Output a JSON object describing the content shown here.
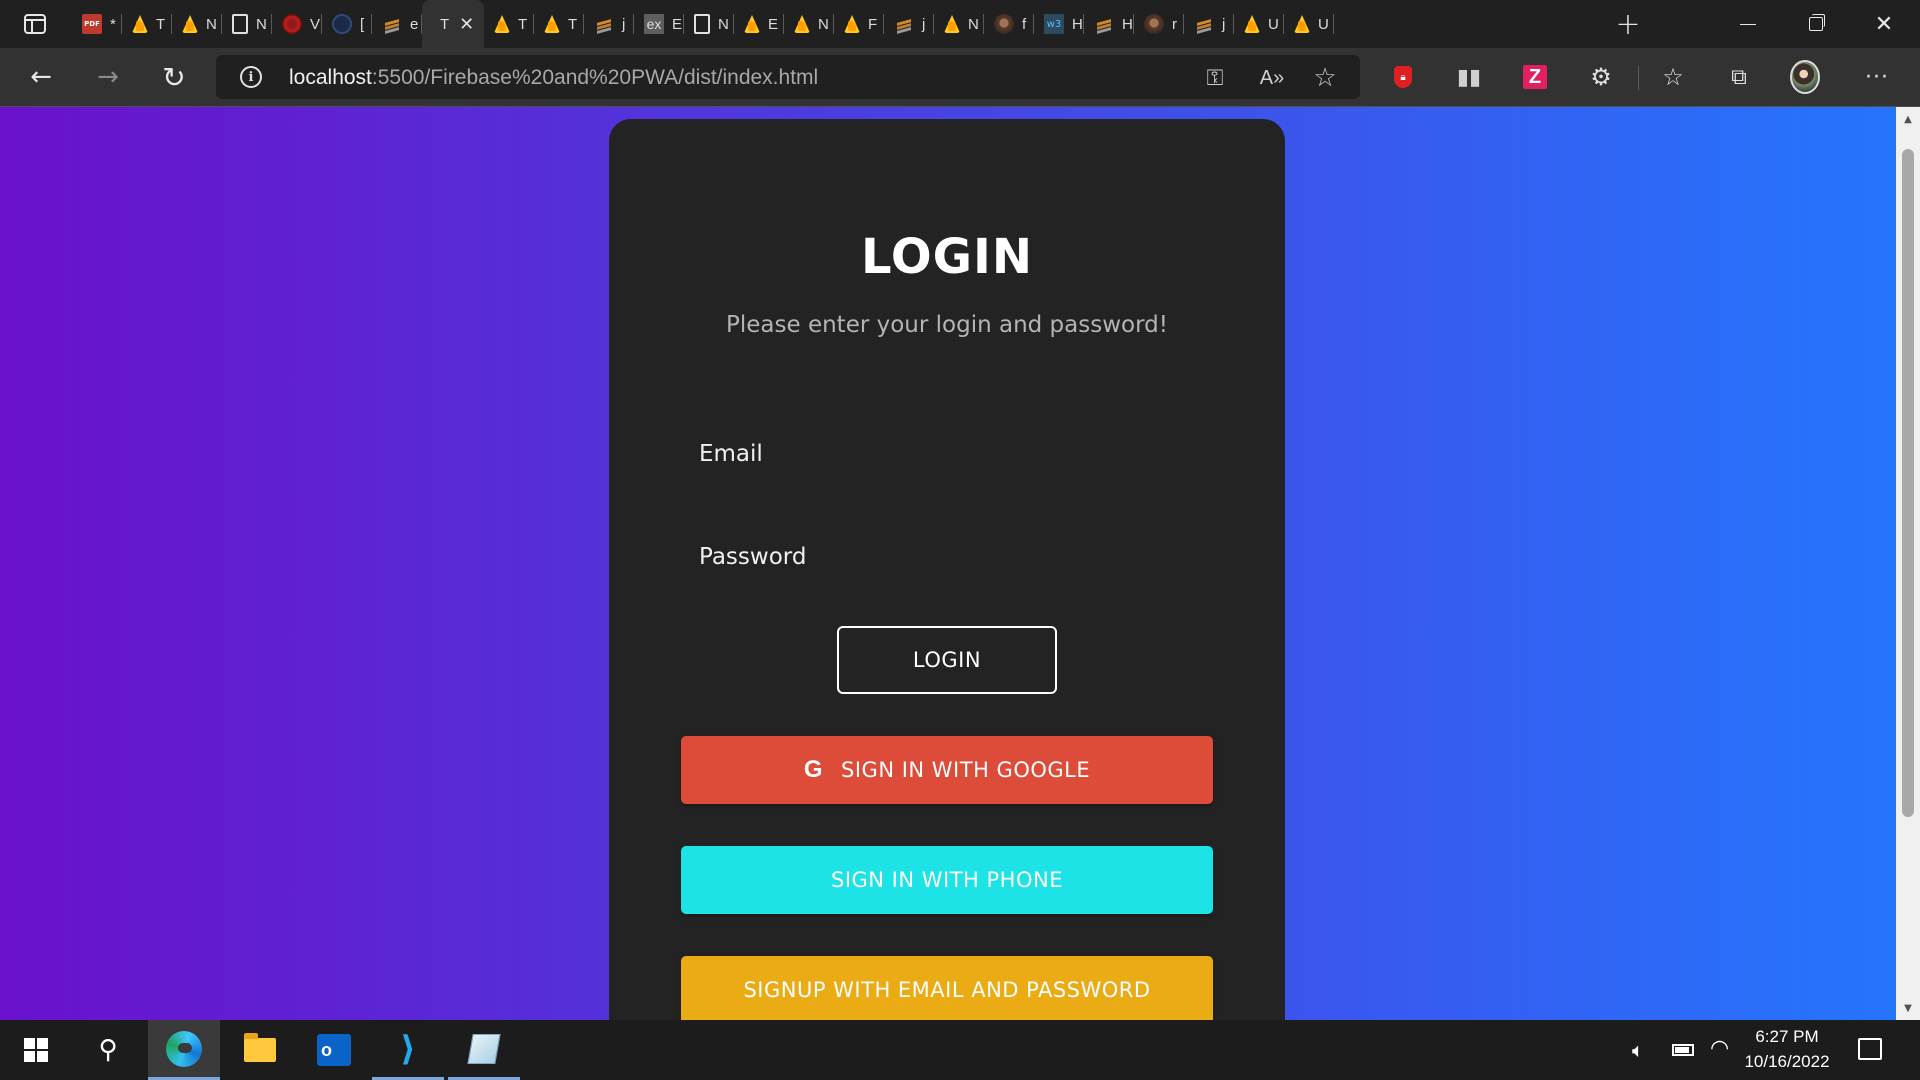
{
  "browser": {
    "tabs": [
      {
        "icon": "pdf-icon",
        "title": "*"
      },
      {
        "icon": "firebase-icon",
        "title": "T"
      },
      {
        "icon": "firebase-icon",
        "title": "N"
      },
      {
        "icon": "page-icon",
        "title": "N"
      },
      {
        "icon": "red-circle-icon",
        "title": "V"
      },
      {
        "icon": "blue-circle-icon",
        "title": "["
      },
      {
        "icon": "stackoverflow-icon",
        "title": "e"
      },
      {
        "icon": "active",
        "title": "T",
        "active": true
      },
      {
        "icon": "firebase-icon",
        "title": "T"
      },
      {
        "icon": "firebase-icon",
        "title": "T"
      },
      {
        "icon": "stackoverflow-icon",
        "title": "j"
      },
      {
        "icon": "ex-icon",
        "title": "E"
      },
      {
        "icon": "page-icon",
        "title": "N"
      },
      {
        "icon": "firebase-icon",
        "title": "E"
      },
      {
        "icon": "firebase-icon",
        "title": "N"
      },
      {
        "icon": "firebase-icon",
        "title": "F"
      },
      {
        "icon": "stackoverflow-icon",
        "title": "j"
      },
      {
        "icon": "firebase-icon",
        "title": "N"
      },
      {
        "icon": "avatar-icon",
        "title": "f"
      },
      {
        "icon": "w3-icon",
        "title": "H"
      },
      {
        "icon": "stackoverflow-icon",
        "title": "H"
      },
      {
        "icon": "avatar-icon",
        "title": "r"
      },
      {
        "icon": "stackoverflow-icon",
        "title": "j"
      },
      {
        "icon": "firebase-icon",
        "title": "U"
      },
      {
        "icon": "firebase-icon",
        "title": "U"
      }
    ],
    "address_bar": {
      "host": "localhost",
      "path": ":5500/Firebase%20and%20PWA/dist/index.html"
    },
    "read_aloud_label": "A»",
    "more_label": "···"
  },
  "page": {
    "title": "LOGIN",
    "subtitle": "Please enter your login and password!",
    "email_label": "Email",
    "password_label": "Password",
    "login_button": "LOGIN",
    "google_icon_letter": "G",
    "google_button": "SIGN IN WITH GOOGLE",
    "phone_button": "SIGN IN WITH PHONE",
    "signup_button": "SIGNUP WITH EMAIL AND PASSWORD",
    "colors": {
      "gradient_start": "#6a11cb",
      "gradient_end": "#2575fc",
      "card": "#232323",
      "google": "#dd4b39",
      "phone": "#1de2e6",
      "signup": "#eaab14"
    }
  },
  "taskbar": {
    "apps": [
      "start-icon",
      "search-icon",
      "edge-icon",
      "file-explorer-icon",
      "outlook-icon",
      "vscode-icon",
      "notepad-icon"
    ],
    "outlook_letter": "o",
    "time": "6:27 PM",
    "date": "10/16/2022"
  }
}
